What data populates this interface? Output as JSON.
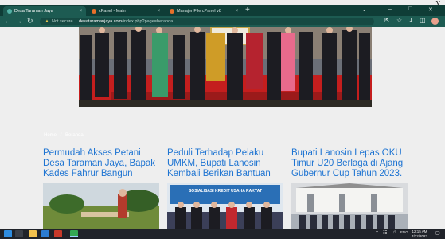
{
  "corner_text": "y",
  "browser": {
    "tabs": [
      {
        "label": "Desa Taraman Jaya",
        "active": true,
        "favicon_color": "#52b2a6"
      },
      {
        "label": "cPanel - Main",
        "active": false,
        "favicon_color": "#e8702a"
      },
      {
        "label": "Manajer File cPanel v8",
        "active": false,
        "favicon_color": "#e8702a"
      }
    ],
    "tab_close_glyph": "×",
    "new_tab_glyph": "+",
    "url": {
      "security_label": "Not secure",
      "host": "desataramanjaya.com",
      "path": "/index.php?page=beranda"
    }
  },
  "page": {
    "breadcrumb": {
      "home": "Home",
      "current": "Beranda"
    },
    "news": [
      {
        "title": "Permudah Akses Petani Desa Taraman Jaya, Bapak Kades Fahrur Bangun"
      },
      {
        "title": "Peduli Terhadap Pelaku UMKM, Bupati Lanosin Kembali Berikan Bantuan"
      },
      {
        "title": "Bupati Lanosin Lepas OKU Timur U20 Berlaga di Ajang Gubernur Cup Tahun 2023."
      }
    ],
    "banner_text": "SOSIALISASI KREDIT USAHA RAKYAT"
  },
  "taskbar": {
    "time": "12:15 AM",
    "date": "7/22/2023",
    "tray_lang": "ENG"
  },
  "colors": {
    "tabstrip": "#0f3d37",
    "toolbar": "#1d5b52",
    "link": "#1e74d2",
    "page_bg": "#eeeeee",
    "taskbar": "#20232a"
  }
}
